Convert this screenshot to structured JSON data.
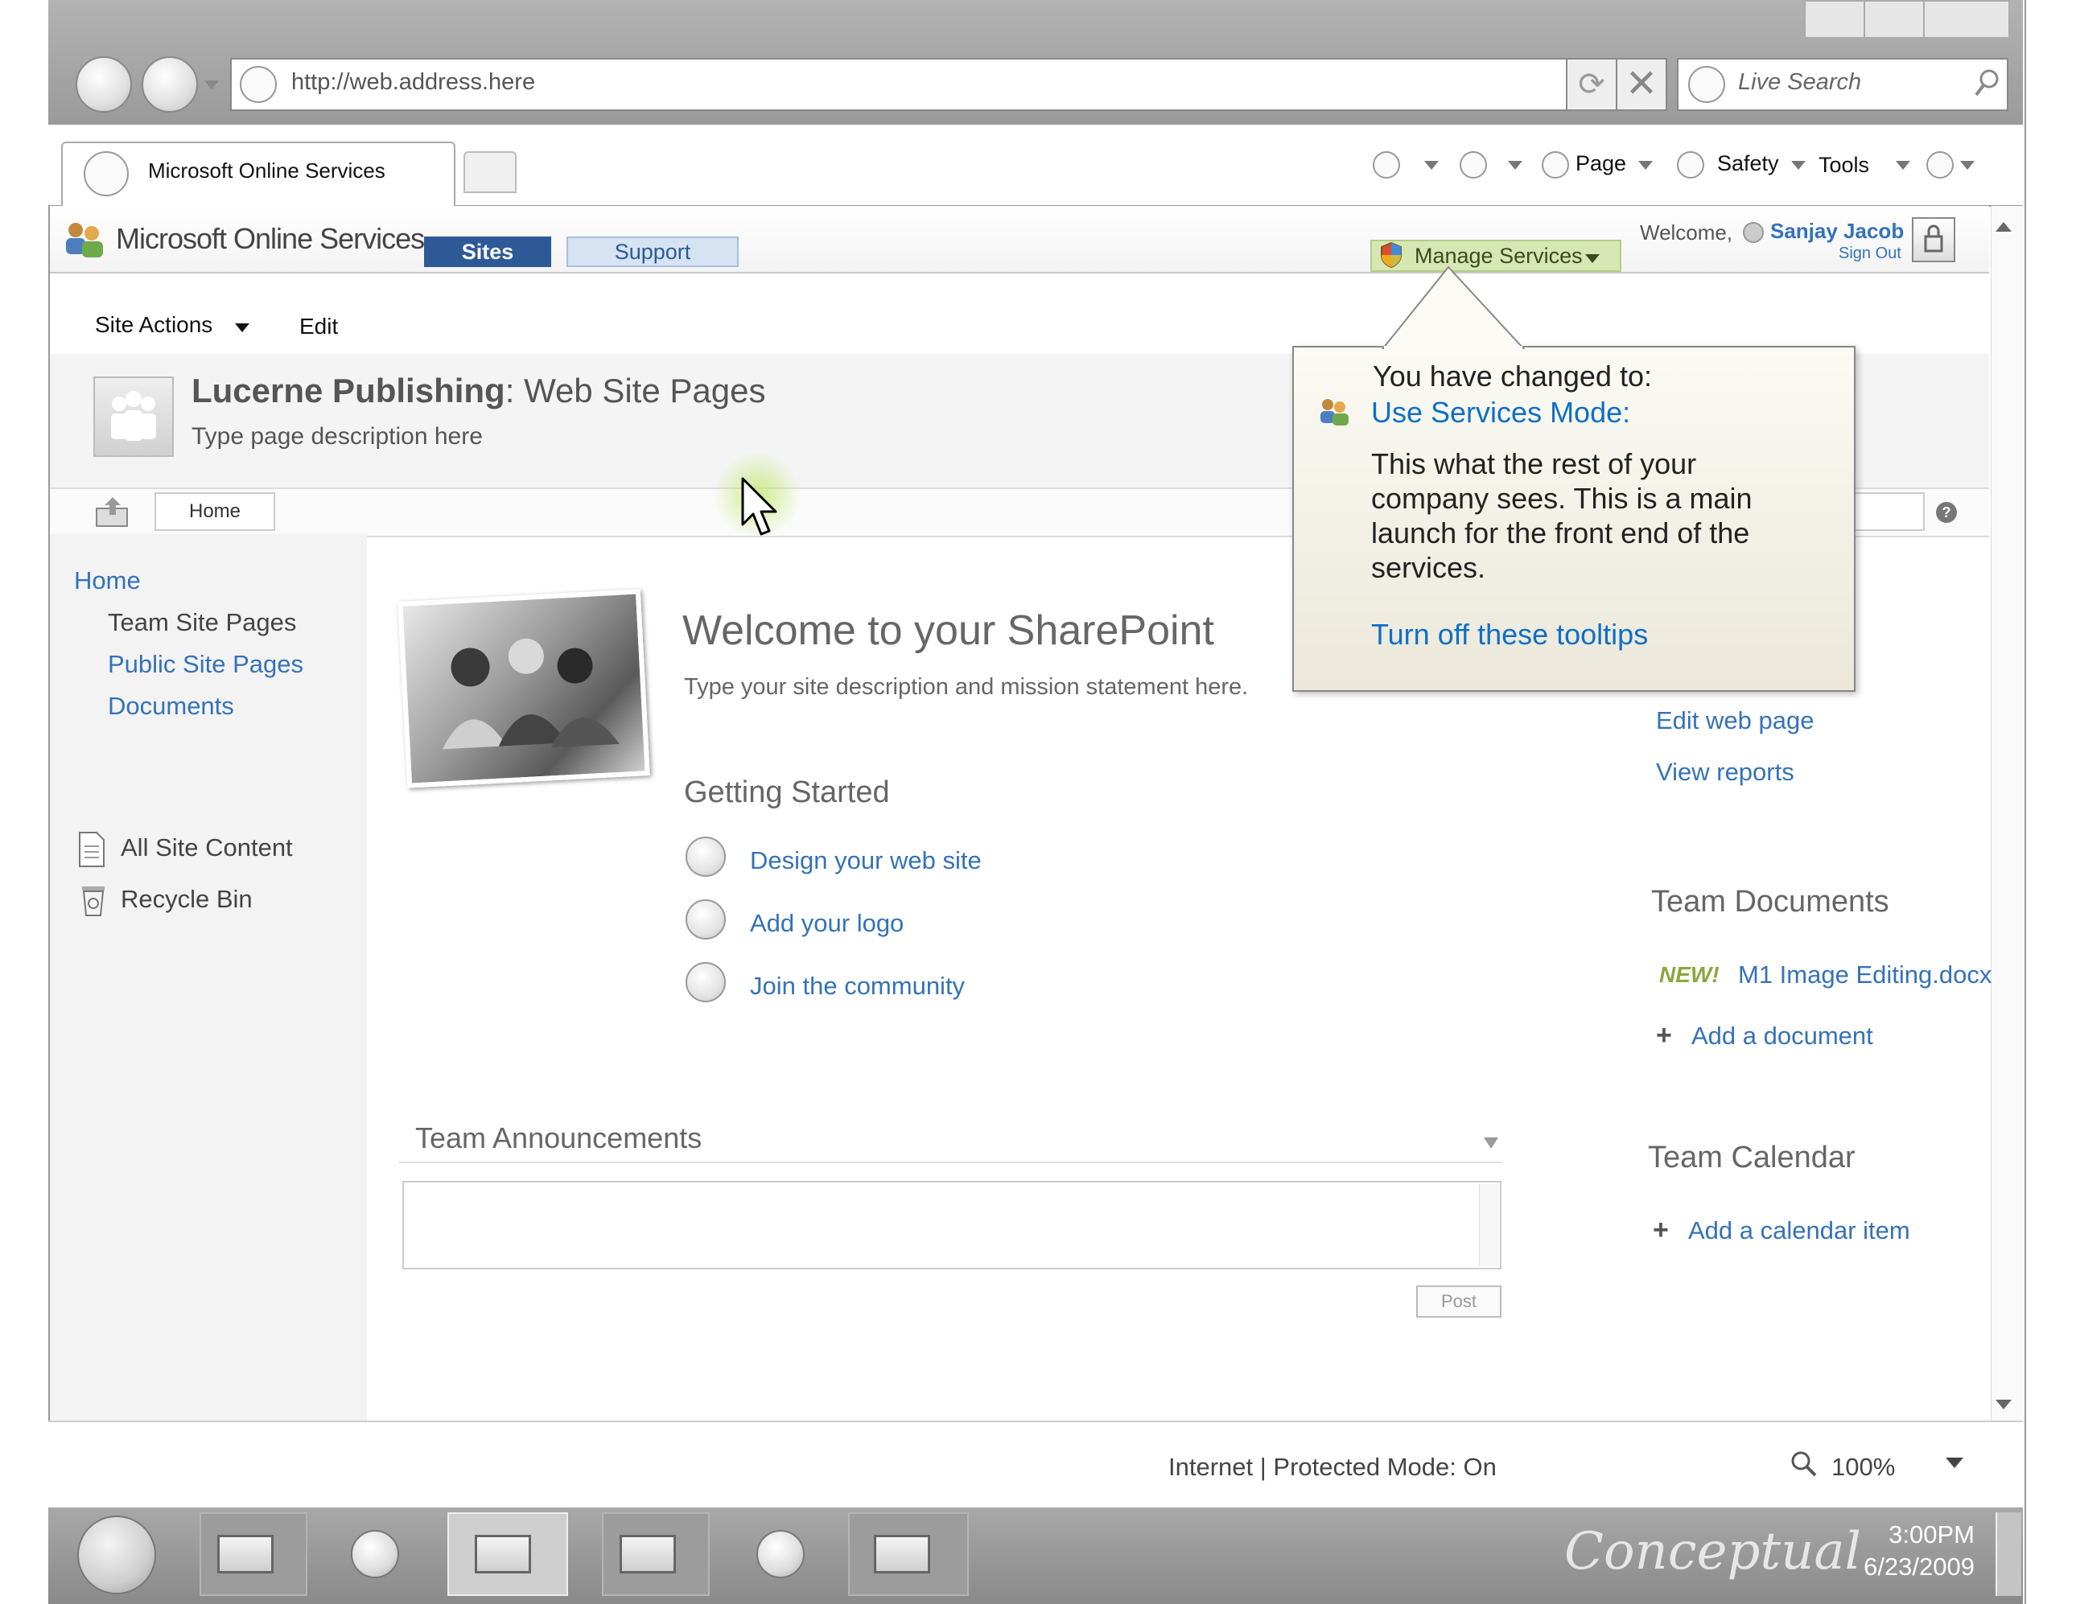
{
  "browser": {
    "address_url": "http://web.address.here",
    "search_placeholder": "Live Search",
    "tab_title": "Microsoft Online Services",
    "toolbar": {
      "page_label": "Page",
      "safety_label": "Safety",
      "tools_label": "Tools"
    }
  },
  "header": {
    "logo_text": "Microsoft Online Services",
    "tabs": [
      {
        "label": "Sites",
        "active": true
      },
      {
        "label": "Support",
        "active": false
      }
    ],
    "manage_services_label": "Manage Services",
    "welcome_label": "Welcome,",
    "user_name": "Sanjay Jacob",
    "sign_out_label": "Sign Out"
  },
  "site_actions": {
    "menu_label": "Site Actions",
    "edit_label": "Edit"
  },
  "page_title": {
    "site_name": "Lucerne Publishing",
    "separator": ":",
    "page_name": "Web Site Pages",
    "description": "Type page description here"
  },
  "breadcrumb": {
    "home_label": "Home"
  },
  "left_nav": {
    "home": "Home",
    "items": [
      "Team Site Pages",
      "Public Site Pages",
      "Documents"
    ],
    "bottom_items": [
      "All Site Content",
      "Recycle Bin"
    ]
  },
  "main": {
    "welcome_heading": "Welcome to your SharePoint",
    "site_description_visible": "Type your site description and mission statement h",
    "site_description_obscured_tail": "ere.",
    "getting_started_heading": "Getting Started",
    "getting_started_items": [
      "Design your web site",
      "Add your logo",
      "Join the community"
    ],
    "announcements_heading": "Team Announcements",
    "post_label": "Post"
  },
  "right_column": {
    "links": [
      "Edit web page",
      "View reports"
    ],
    "documents_heading": "Team Documents",
    "new_badge": "NEW!",
    "document_name": "M1 Image Editing.docx",
    "add_document_label": "Add a document",
    "calendar_heading": "Team Calendar",
    "add_calendar_label": "Add a calendar item",
    "plus_glyph": "+"
  },
  "tooltip": {
    "line1": "You have changed to:",
    "mode_link": "Use Services Mode:",
    "body_lines": [
      "This what the rest of your",
      "company sees.  This is a main",
      "launch for the front end of the",
      "services."
    ],
    "turn_off_link": "Turn off these tooltips"
  },
  "status_bar": {
    "zone_text": "Internet | Protected Mode: On",
    "zoom": "100%"
  },
  "taskbar": {
    "watermark": "Conceptual",
    "time": "3:00PM",
    "date": "6/23/2009"
  },
  "colors": {
    "link": "#3572b8",
    "sites_tab": "#2d5a96",
    "manage_services_bg": "#d6e7b3",
    "new_badge": "#8aa83d",
    "tooltip_link": "#0f6fc6"
  },
  "icons": [
    "back-icon",
    "forward-icon",
    "refresh-icon",
    "stop-icon",
    "search-icon",
    "home-icon",
    "feeds-icon",
    "print-icon",
    "help-icon",
    "shield-icon",
    "lock-icon",
    "up-folder-icon",
    "document-icon",
    "recycle-bin-icon",
    "people-icon",
    "zoom-icon"
  ]
}
